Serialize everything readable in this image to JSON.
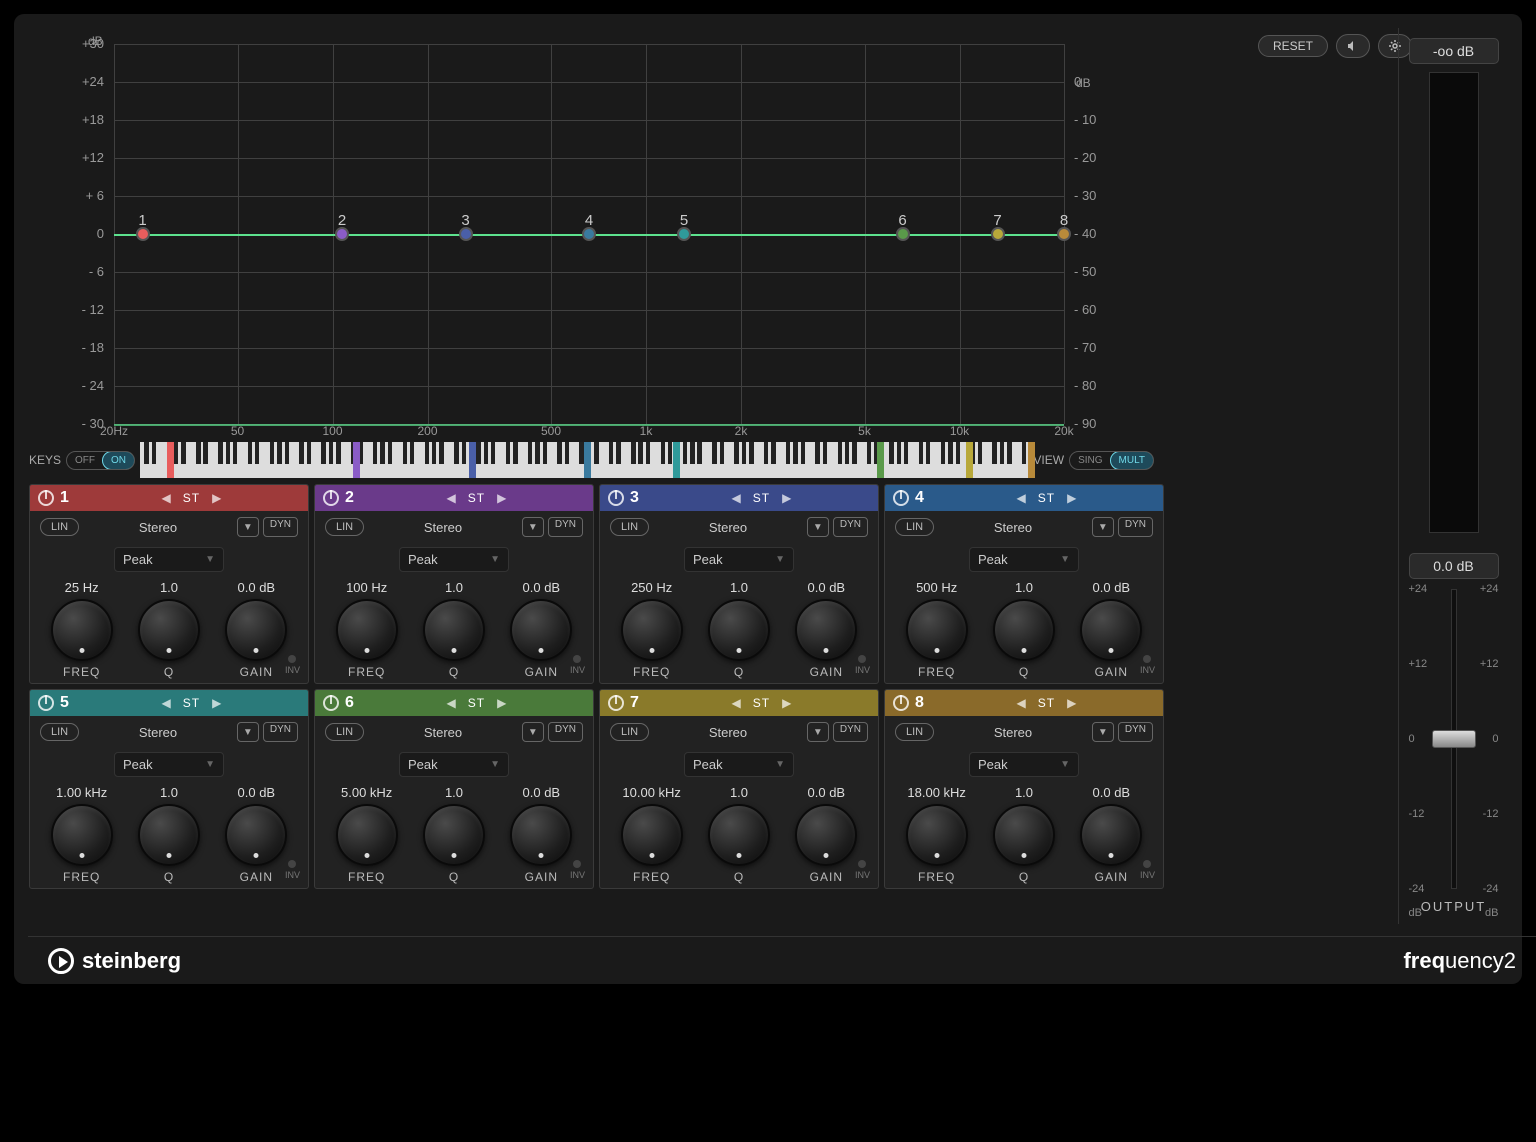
{
  "header": {
    "reset": "RESET",
    "output_readout": "-oo dB",
    "output_gain": "0.0 dB",
    "output_label": "OUTPUT"
  },
  "graph": {
    "left_unit": "dB",
    "right_unit": "dB",
    "left_ticks": [
      "+30",
      "+24",
      "+18",
      "+12",
      "+ 6",
      "0",
      "- 6",
      "- 12",
      "- 18",
      "- 24",
      "- 30"
    ],
    "right_ticks": [
      "0",
      "- 10",
      "- 20",
      "- 30",
      "- 40",
      "- 50",
      "- 60",
      "- 70",
      "- 80",
      "- 90"
    ],
    "freq_ticks": [
      "20Hz",
      "50",
      "100",
      "200",
      "500",
      "1k",
      "2k",
      "5k",
      "10k",
      "20k"
    ],
    "nodes": [
      {
        "n": "1",
        "pct": 3,
        "color": "#e85d5d"
      },
      {
        "n": "2",
        "pct": 24,
        "color": "#8a5cc7"
      },
      {
        "n": "3",
        "pct": 37,
        "color": "#4a5fa8"
      },
      {
        "n": "4",
        "pct": 50,
        "color": "#3a7a9e"
      },
      {
        "n": "5",
        "pct": 60,
        "color": "#2f9a9a"
      },
      {
        "n": "6",
        "pct": 83,
        "color": "#5a9a4a"
      },
      {
        "n": "7",
        "pct": 93,
        "color": "#b8a83a"
      },
      {
        "n": "8",
        "pct": 100,
        "color": "#b88a3a"
      }
    ]
  },
  "keys": {
    "label": "KEYS",
    "off": "OFF",
    "on": "ON",
    "view": "VIEW",
    "sing": "SING",
    "mult": "MULT"
  },
  "slider_ticks": [
    "+24",
    "+12",
    "0",
    "-12",
    "-24"
  ],
  "slider_unit": "dB",
  "bands": [
    {
      "n": "1",
      "color": "#9e3a3a",
      "freq": "25 Hz",
      "q": "1.0",
      "gain": "0.0 dB",
      "filter": "Peak",
      "mode": "Stereo",
      "lin": "LIN",
      "dyn": "DYN",
      "st": "ST"
    },
    {
      "n": "2",
      "color": "#6a3a8a",
      "freq": "100 Hz",
      "q": "1.0",
      "gain": "0.0 dB",
      "filter": "Peak",
      "mode": "Stereo",
      "lin": "LIN",
      "dyn": "DYN",
      "st": "ST"
    },
    {
      "n": "3",
      "color": "#3a4a8a",
      "freq": "250 Hz",
      "q": "1.0",
      "gain": "0.0 dB",
      "filter": "Peak",
      "mode": "Stereo",
      "lin": "LIN",
      "dyn": "DYN",
      "st": "ST"
    },
    {
      "n": "4",
      "color": "#2a5a8a",
      "freq": "500 Hz",
      "q": "1.0",
      "gain": "0.0 dB",
      "filter": "Peak",
      "mode": "Stereo",
      "lin": "LIN",
      "dyn": "DYN",
      "st": "ST"
    },
    {
      "n": "5",
      "color": "#2a7a7a",
      "freq": "1.00 kHz",
      "q": "1.0",
      "gain": "0.0 dB",
      "filter": "Peak",
      "mode": "Stereo",
      "lin": "LIN",
      "dyn": "DYN",
      "st": "ST"
    },
    {
      "n": "6",
      "color": "#4a7a3a",
      "freq": "5.00 kHz",
      "q": "1.0",
      "gain": "0.0 dB",
      "filter": "Peak",
      "mode": "Stereo",
      "lin": "LIN",
      "dyn": "DYN",
      "st": "ST"
    },
    {
      "n": "7",
      "color": "#8a7a2a",
      "freq": "10.00 kHz",
      "q": "1.0",
      "gain": "0.0 dB",
      "filter": "Peak",
      "mode": "Stereo",
      "lin": "LIN",
      "dyn": "DYN",
      "st": "ST"
    },
    {
      "n": "8",
      "color": "#8a6a2a",
      "freq": "18.00 kHz",
      "q": "1.0",
      "gain": "0.0 dB",
      "filter": "Peak",
      "mode": "Stereo",
      "lin": "LIN",
      "dyn": "DYN",
      "st": "ST"
    }
  ],
  "band_labels": {
    "freq": "FREQ",
    "q": "Q",
    "gain": "GAIN",
    "inv": "INV"
  },
  "footer": {
    "brand": "steinberg",
    "product_bold": "freq",
    "product_rest": "uency2"
  }
}
